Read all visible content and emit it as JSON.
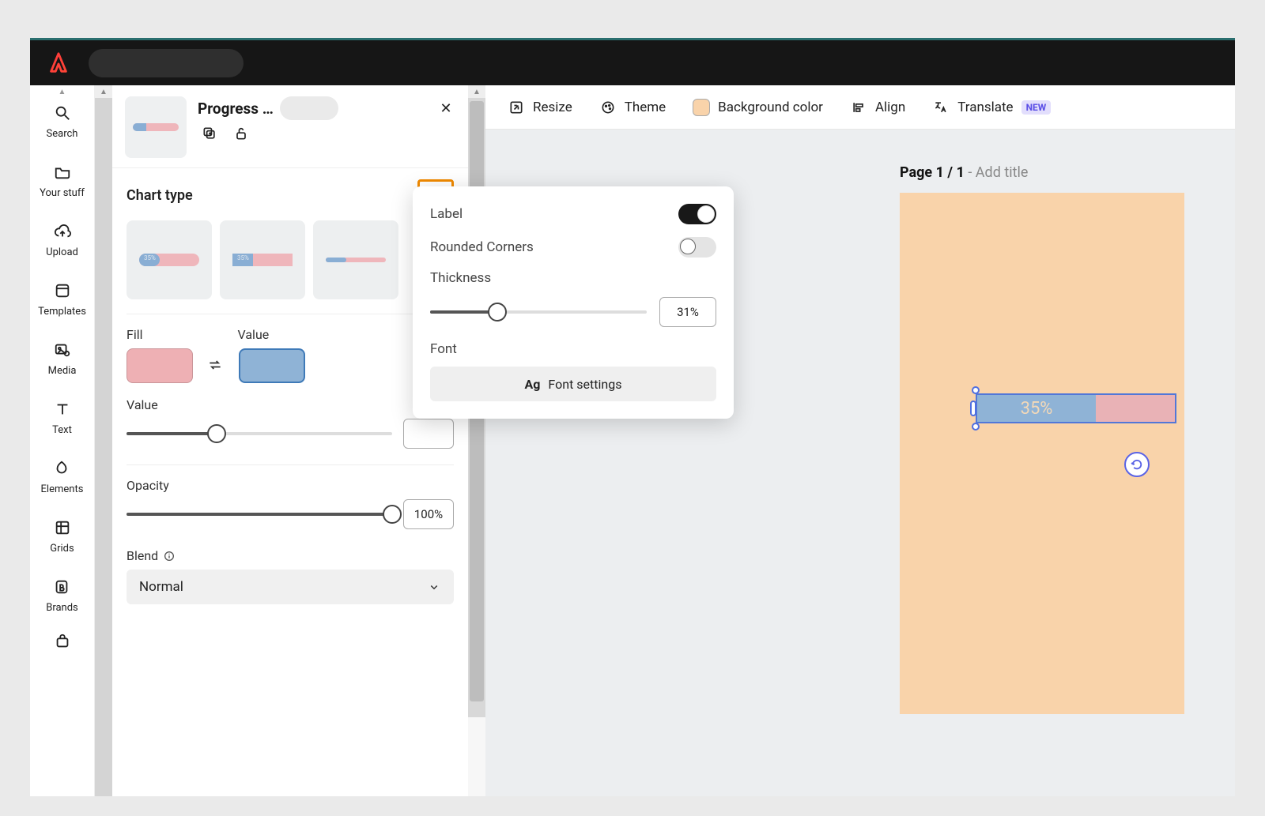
{
  "leftnav": {
    "items": [
      {
        "label": "Search",
        "icon": "search-icon"
      },
      {
        "label": "Your stuff",
        "icon": "folder-icon"
      },
      {
        "label": "Upload",
        "icon": "cloud-upload-icon"
      },
      {
        "label": "Templates",
        "icon": "templates-icon"
      },
      {
        "label": "Media",
        "icon": "media-icon"
      },
      {
        "label": "Text",
        "icon": "text-icon"
      },
      {
        "label": "Elements",
        "icon": "shapes-icon"
      },
      {
        "label": "Grids",
        "icon": "grids-icon"
      },
      {
        "label": "Brands",
        "icon": "brands-icon"
      }
    ]
  },
  "panel": {
    "title": "Progress …",
    "chart_type_label": "Chart type",
    "fill_label": "Fill",
    "value_color_label": "Value",
    "value_slider_label": "Value",
    "opacity_label": "Opacity",
    "opacity_value": "100%",
    "blend_label": "Blend",
    "blend_value": "Normal",
    "colors": {
      "fill": "#eeb0b4",
      "value": "#8fb3d6"
    }
  },
  "popover": {
    "label_toggle_label": "Label",
    "label_toggle_on": true,
    "rounded_label": "Rounded Corners",
    "rounded_on": false,
    "thickness_label": "Thickness",
    "thickness_value": "31%",
    "thickness_pct": 31,
    "font_label": "Font",
    "font_button": "Font settings"
  },
  "toolbar": {
    "resize": "Resize",
    "theme": "Theme",
    "bgcolor": "Background color",
    "align": "Align",
    "translate": "Translate",
    "new_badge": "NEW"
  },
  "canvas": {
    "page_strong": "Page 1 / 1",
    "page_mute": " - Add title",
    "progress_label": "35%",
    "artboard_color": "#f9d3aa"
  }
}
